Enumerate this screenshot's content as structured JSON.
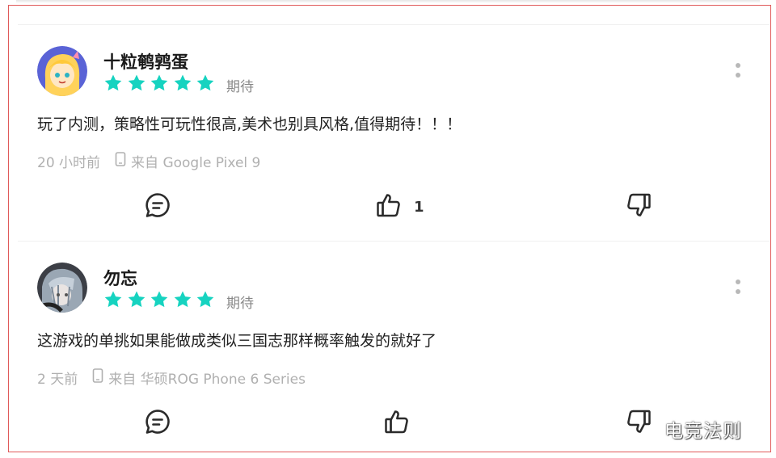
{
  "reviews": [
    {
      "username": "十粒鹌鹑蛋",
      "rating": 5,
      "tag": "期待",
      "content": "玩了内测，策略性可玩性很高,美术也别具风格,值得期待！！！",
      "time": "20 小时前",
      "device": "来自 Google Pixel 9",
      "like_count": "1"
    },
    {
      "username": "勿忘",
      "rating": 5,
      "tag": "期待",
      "content": "这游戏的单挑如果能做成类似三国志那样概率触发的就好了",
      "time": "2 天前",
      "device": "来自 华硕ROG Phone 6 Series",
      "like_count": ""
    }
  ],
  "watermark": "电竞法则",
  "colors": {
    "star": "#16d3c0",
    "frame": "#e05a5a",
    "icon": "#2b2b2b",
    "meta": "#b0b0b0"
  },
  "icons": [
    "avatar",
    "star-icon",
    "more-icon",
    "phone-icon",
    "comment-icon",
    "thumb-up-icon",
    "thumb-down-icon"
  ]
}
